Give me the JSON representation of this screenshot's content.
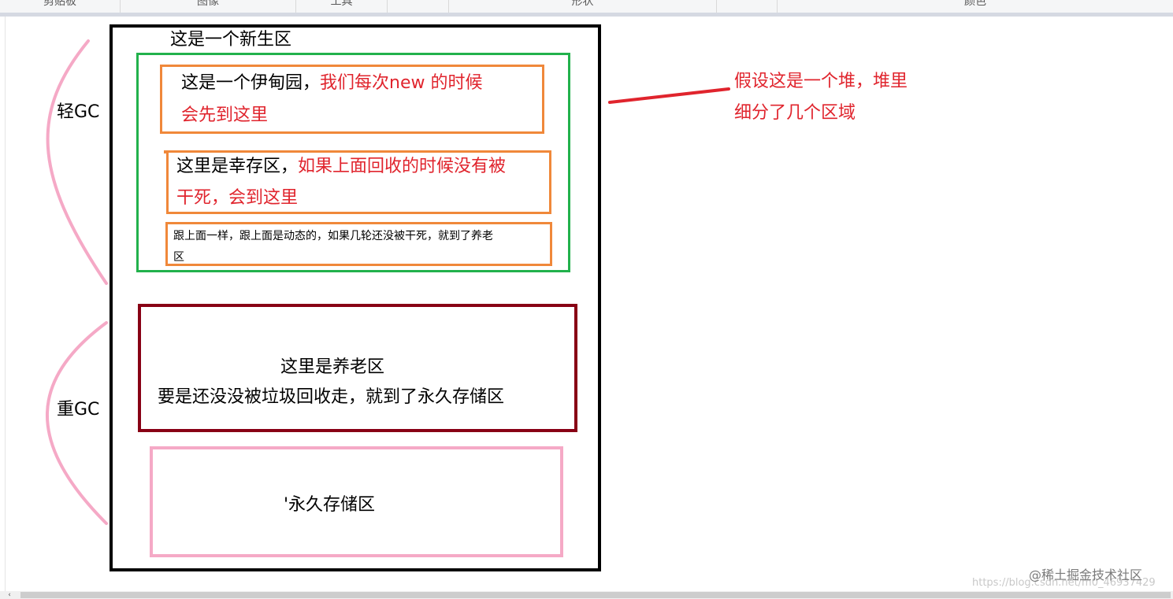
{
  "ribbon": {
    "groups": [
      "剪贴板",
      "图像",
      "工具",
      "",
      "形状",
      "",
      "颜色"
    ]
  },
  "diagram": {
    "new_gen_title": "这是一个新生区",
    "eden": {
      "black": "这是一个伊甸园，",
      "red_line1": "我们每次new 的时候",
      "red_line2": "会先到这里"
    },
    "survivor": {
      "black": "这里是幸存区，",
      "red_line1": "如果上面回收的时候没有被",
      "red_line2": "干死，会到这里"
    },
    "survivor2": {
      "line1": "跟上面一样，跟上面是动态的，如果几轮还没被干死，就到了养老",
      "line2": "区"
    },
    "old_gen": {
      "line1": "这里是养老区",
      "line2": "要是还没没被垃圾回收走，就到了永久存储区"
    },
    "perm_gen": {
      "label": "'永久存储区"
    },
    "minor_gc_label": "轻GC",
    "major_gc_label": "重GC",
    "heap_note": {
      "line1": "假设这是一个堆，堆里",
      "line2": "细分了几个区域"
    },
    "colors": {
      "heap_border": "#000000",
      "new_gen_border": "#22b14c",
      "eden_border": "#f0883a",
      "old_gen_border": "#880015",
      "perm_border": "#f5a9c6",
      "brace": "#f5a9c6",
      "note_red": "#e0242d"
    }
  },
  "watermark": {
    "juejin": "@稀土掘金技术社区",
    "url": "https://blog.csdn.net/m0_46937429"
  },
  "scrollbar": {
    "left_arrow": "‹"
  }
}
